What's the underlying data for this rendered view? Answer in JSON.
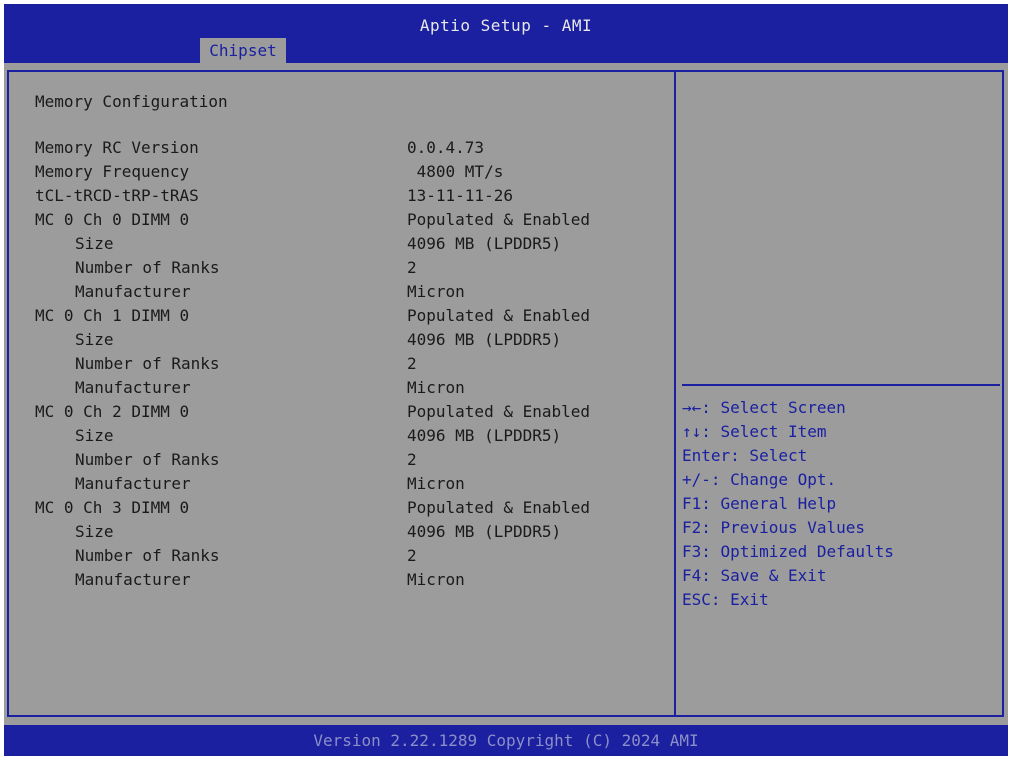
{
  "header": {
    "title": "Aptio Setup - AMI",
    "tabs": [
      {
        "label": "Chipset",
        "active": true
      }
    ]
  },
  "main": {
    "heading": "Memory Configuration",
    "rows": [
      {
        "label": "Memory RC Version",
        "value": "0.0.4.73",
        "indent": false
      },
      {
        "label": "Memory Frequency",
        "value": " 4800 MT/s",
        "indent": false
      },
      {
        "label": "tCL-tRCD-tRP-tRAS",
        "value": "13-11-11-26",
        "indent": false
      },
      {
        "label": "MC 0 Ch 0 DIMM 0",
        "value": "Populated & Enabled",
        "indent": false
      },
      {
        "label": "Size",
        "value": "4096 MB (LPDDR5)",
        "indent": true
      },
      {
        "label": "Number of Ranks",
        "value": "2",
        "indent": true
      },
      {
        "label": "Manufacturer",
        "value": "Micron",
        "indent": true
      },
      {
        "label": "MC 0 Ch 1 DIMM 0",
        "value": "Populated & Enabled",
        "indent": false
      },
      {
        "label": "Size",
        "value": "4096 MB (LPDDR5)",
        "indent": true
      },
      {
        "label": "Number of Ranks",
        "value": "2",
        "indent": true
      },
      {
        "label": "Manufacturer",
        "value": "Micron",
        "indent": true
      },
      {
        "label": "MC 0 Ch 2 DIMM 0",
        "value": "Populated & Enabled",
        "indent": false
      },
      {
        "label": "Size",
        "value": "4096 MB (LPDDR5)",
        "indent": true
      },
      {
        "label": "Number of Ranks",
        "value": "2",
        "indent": true
      },
      {
        "label": "Manufacturer",
        "value": "Micron",
        "indent": true
      },
      {
        "label": "MC 0 Ch 3 DIMM 0",
        "value": "Populated & Enabled",
        "indent": false
      },
      {
        "label": "Size",
        "value": "4096 MB (LPDDR5)",
        "indent": true
      },
      {
        "label": "Number of Ranks",
        "value": "2",
        "indent": true
      },
      {
        "label": "Manufacturer",
        "value": "Micron",
        "indent": true
      }
    ]
  },
  "help": {
    "lines": [
      "→←: Select Screen",
      "↑↓: Select Item",
      "Enter: Select",
      "+/-: Change Opt.",
      "F1: General Help",
      "F2: Previous Values",
      "F3: Optimized Defaults",
      "F4: Save & Exit",
      "ESC: Exit"
    ]
  },
  "footer": {
    "text": "Version 2.22.1289 Copyright (C) 2024 AMI"
  },
  "colors": {
    "bar_blue": "#1a20a0",
    "panel_gray": "#9c9c9c",
    "footer_text": "#8c8fc6"
  }
}
